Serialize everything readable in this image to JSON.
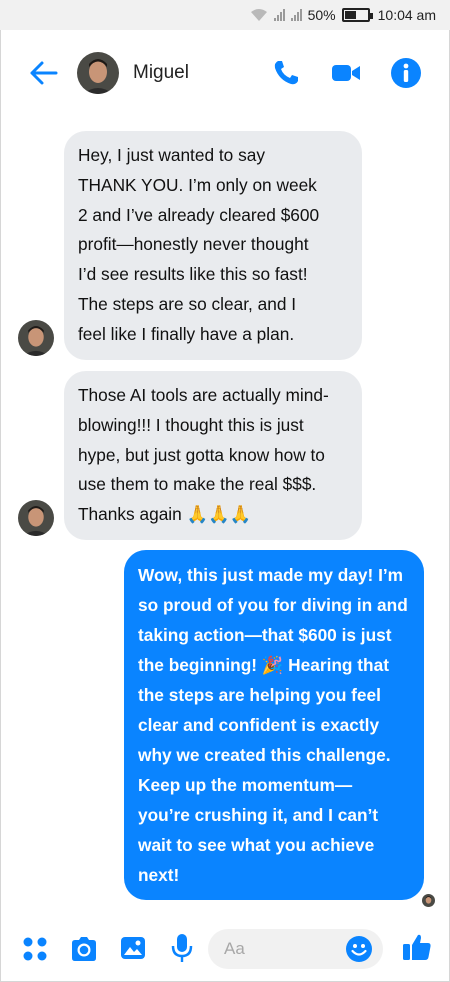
{
  "status_bar": {
    "battery_percent": "50%",
    "battery_level": 0.5,
    "time": "10:04 am"
  },
  "header": {
    "contact_name": "Miguel",
    "icons": [
      "back-arrow-icon",
      "phone-icon",
      "video-camera-icon",
      "info-icon"
    ]
  },
  "messages": [
    {
      "direction": "incoming",
      "lines": [
        "Hey, I just wanted to say",
        "THANK YOU. I’m only on week",
        "2 and I’ve already cleared $600",
        "profit—honestly never thought",
        "I’d see results like this so fast!",
        "The steps are so clear, and I",
        "feel like I finally have a plan."
      ]
    },
    {
      "direction": "incoming",
      "lines": [
        "Those AI tools are actually mind-",
        "blowing!!! I thought this is just",
        "hype, but just gotta know how to",
        "use them to make the real $$$.",
        "Thanks again 🙏🙏🙏"
      ]
    },
    {
      "direction": "outgoing",
      "lines": [
        "Wow, this just made my day! I’m",
        "so proud of you for diving in and",
        "taking action—that $600 is just",
        "the beginning! 🎉 Hearing that",
        "the steps are helping you feel",
        "clear and confident is exactly",
        "why we created this challenge.",
        "Keep up the momentum—",
        "you’re crushing it, and I can’t",
        "wait to see what you achieve",
        "next!"
      ]
    }
  ],
  "composer": {
    "placeholder": "Aa",
    "icons": [
      "apps-grid-icon",
      "camera-icon",
      "gallery-icon",
      "microphone-icon",
      "emoji-icon",
      "thumbs-up-icon"
    ]
  },
  "colors": {
    "accent": "#0a84ff",
    "incoming_bubble": "#e9ebee"
  }
}
